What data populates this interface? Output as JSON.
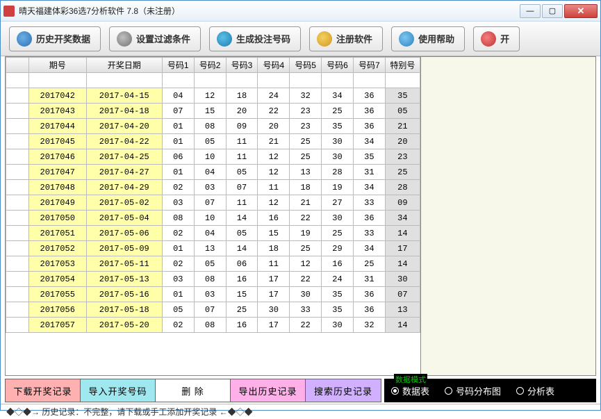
{
  "window": {
    "title": "晴天福建体彩36选7分析软件 7.8（未注册）"
  },
  "toolbar": {
    "history": "历史开奖数据",
    "filter": "设置过滤条件",
    "generate": "生成投注号码",
    "register": "注册软件",
    "help": "使用帮助",
    "open": "开"
  },
  "table": {
    "headers": {
      "issue": "期号",
      "date": "开奖日期",
      "n1": "号码1",
      "n2": "号码2",
      "n3": "号码3",
      "n4": "号码4",
      "n5": "号码5",
      "n6": "号码6",
      "n7": "号码7",
      "special": "特别号"
    },
    "rows": [
      {
        "issue": "2017042",
        "date": "2017-04-15",
        "n": [
          "04",
          "12",
          "18",
          "24",
          "32",
          "34",
          "36"
        ],
        "sp": "35"
      },
      {
        "issue": "2017043",
        "date": "2017-04-18",
        "n": [
          "07",
          "15",
          "20",
          "22",
          "23",
          "25",
          "36"
        ],
        "sp": "05"
      },
      {
        "issue": "2017044",
        "date": "2017-04-20",
        "n": [
          "01",
          "08",
          "09",
          "20",
          "23",
          "35",
          "36"
        ],
        "sp": "21"
      },
      {
        "issue": "2017045",
        "date": "2017-04-22",
        "n": [
          "01",
          "05",
          "11",
          "21",
          "25",
          "30",
          "34"
        ],
        "sp": "20"
      },
      {
        "issue": "2017046",
        "date": "2017-04-25",
        "n": [
          "06",
          "10",
          "11",
          "12",
          "25",
          "30",
          "35"
        ],
        "sp": "23"
      },
      {
        "issue": "2017047",
        "date": "2017-04-27",
        "n": [
          "01",
          "04",
          "05",
          "12",
          "13",
          "28",
          "31"
        ],
        "sp": "25"
      },
      {
        "issue": "2017048",
        "date": "2017-04-29",
        "n": [
          "02",
          "03",
          "07",
          "11",
          "18",
          "19",
          "34"
        ],
        "sp": "28"
      },
      {
        "issue": "2017049",
        "date": "2017-05-02",
        "n": [
          "03",
          "07",
          "11",
          "12",
          "21",
          "27",
          "33"
        ],
        "sp": "09"
      },
      {
        "issue": "2017050",
        "date": "2017-05-04",
        "n": [
          "08",
          "10",
          "14",
          "16",
          "22",
          "30",
          "36"
        ],
        "sp": "34"
      },
      {
        "issue": "2017051",
        "date": "2017-05-06",
        "n": [
          "02",
          "04",
          "05",
          "15",
          "19",
          "25",
          "33"
        ],
        "sp": "14"
      },
      {
        "issue": "2017052",
        "date": "2017-05-09",
        "n": [
          "01",
          "13",
          "14",
          "18",
          "25",
          "29",
          "34"
        ],
        "sp": "17"
      },
      {
        "issue": "2017053",
        "date": "2017-05-11",
        "n": [
          "02",
          "05",
          "06",
          "11",
          "12",
          "16",
          "25"
        ],
        "sp": "14"
      },
      {
        "issue": "2017054",
        "date": "2017-05-13",
        "n": [
          "03",
          "08",
          "16",
          "17",
          "22",
          "24",
          "31"
        ],
        "sp": "30"
      },
      {
        "issue": "2017055",
        "date": "2017-05-16",
        "n": [
          "01",
          "03",
          "15",
          "17",
          "30",
          "35",
          "36"
        ],
        "sp": "07"
      },
      {
        "issue": "2017056",
        "date": "2017-05-18",
        "n": [
          "05",
          "07",
          "25",
          "30",
          "33",
          "35",
          "36"
        ],
        "sp": "13"
      },
      {
        "issue": "2017057",
        "date": "2017-05-20",
        "n": [
          "02",
          "08",
          "16",
          "17",
          "22",
          "30",
          "32"
        ],
        "sp": "14"
      }
    ]
  },
  "actions": {
    "download": "下载开奖记录",
    "import": "导入开奖号码",
    "delete": "删  除",
    "export": "导出历史记录",
    "search": "搜索历史记录"
  },
  "mode": {
    "legend": "数据模式",
    "opt1": "数据表",
    "opt2": "号码分布图",
    "opt3": "分析表"
  },
  "status": "◆◇◆→ 历史记录：不完整，请下载或手工添加开奖记录 ←◆◇◆"
}
